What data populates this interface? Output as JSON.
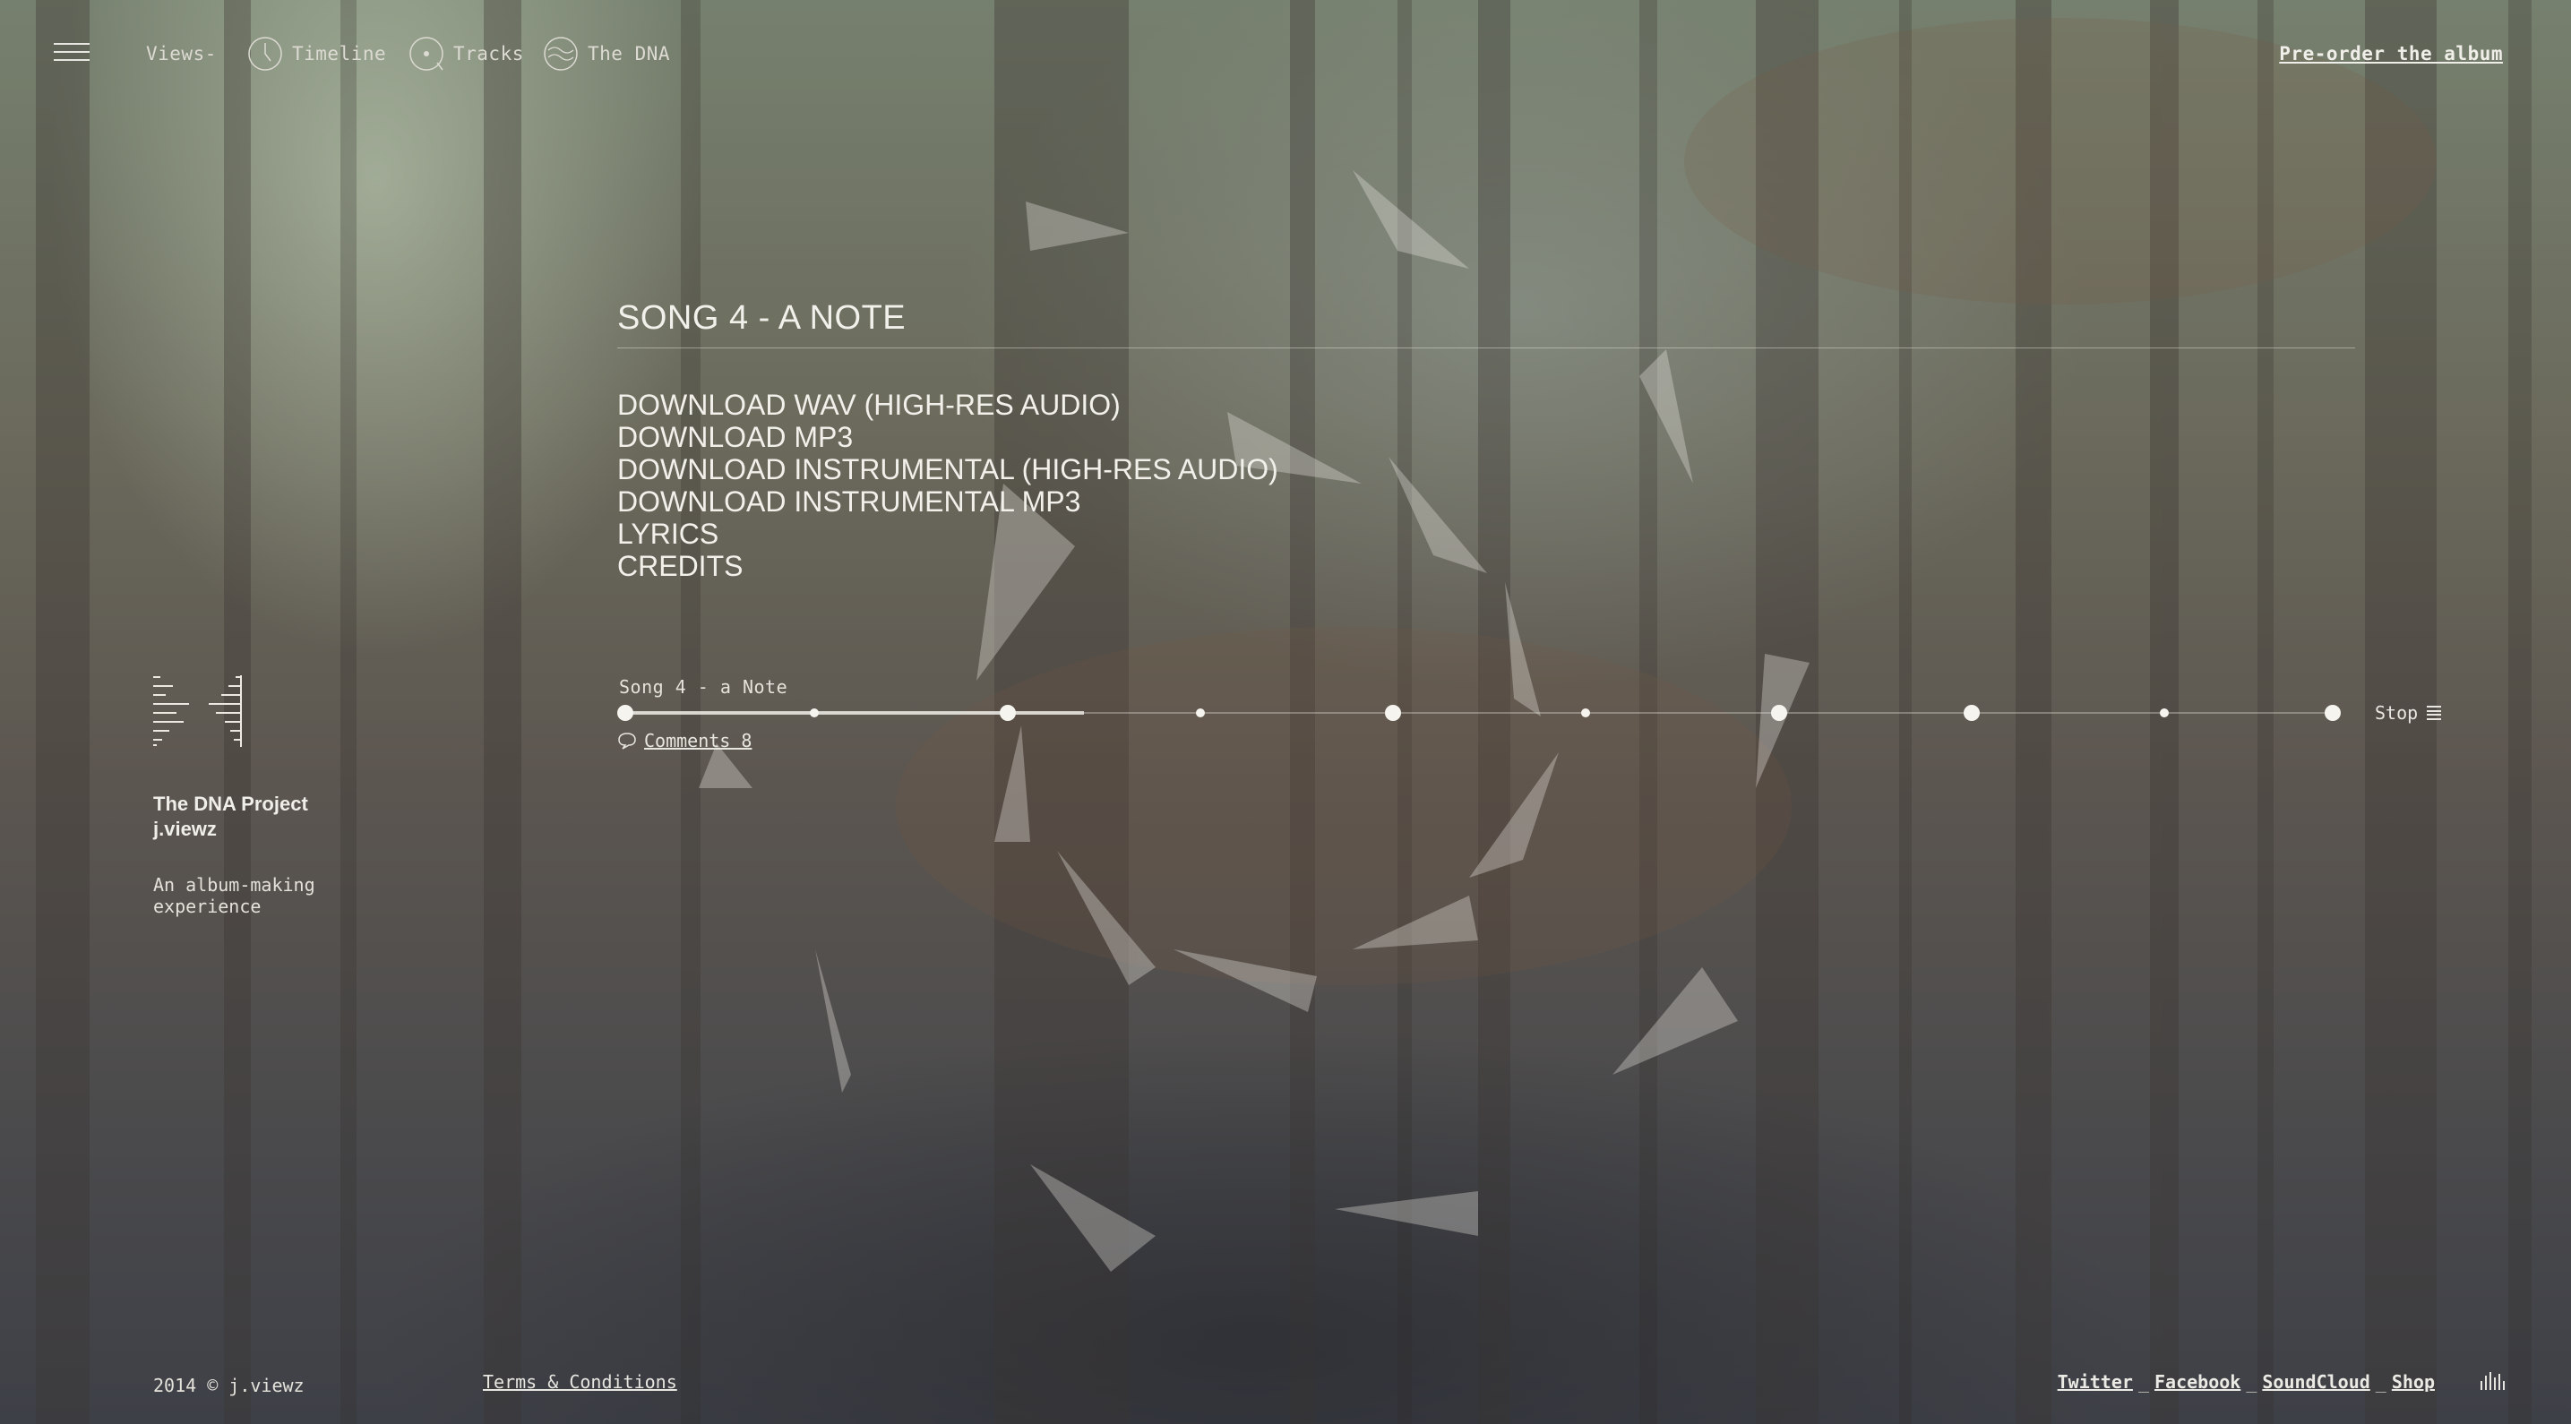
{
  "nav": {
    "views_label": "Views",
    "items": [
      {
        "label": "Timeline",
        "icon": "clock-icon"
      },
      {
        "label": "Tracks",
        "icon": "tracks-icon"
      },
      {
        "label": "The DNA",
        "icon": "dna-icon"
      }
    ],
    "preorder_label": "Pre-order the album"
  },
  "song": {
    "title": "SONG 4 - A NOTE",
    "menu": [
      "DOWNLOAD WAV (HIGH-RES AUDIO)",
      "DOWNLOAD MP3",
      "DOWNLOAD INSTRUMENTAL (HIGH-RES AUDIO)",
      "DOWNLOAD INSTRUMENTAL MP3",
      "LYRICS",
      "CREDITS"
    ]
  },
  "player": {
    "now_playing": "Song 4 - a Note",
    "stop_label": "Stop",
    "comments_label": "Comments 8",
    "progress_fraction": 0.27
  },
  "sidebar": {
    "project": "The DNA Project",
    "artist": "j.viewz",
    "tagline": "An album-making experience"
  },
  "footer": {
    "copyright": "2014 © j.viewz",
    "terms": "Terms & Conditions",
    "social": [
      "Twitter",
      "Facebook",
      "SoundCloud",
      "Shop"
    ]
  },
  "colors": {
    "text": "#eceae4",
    "accent": "#f6f4ee"
  }
}
